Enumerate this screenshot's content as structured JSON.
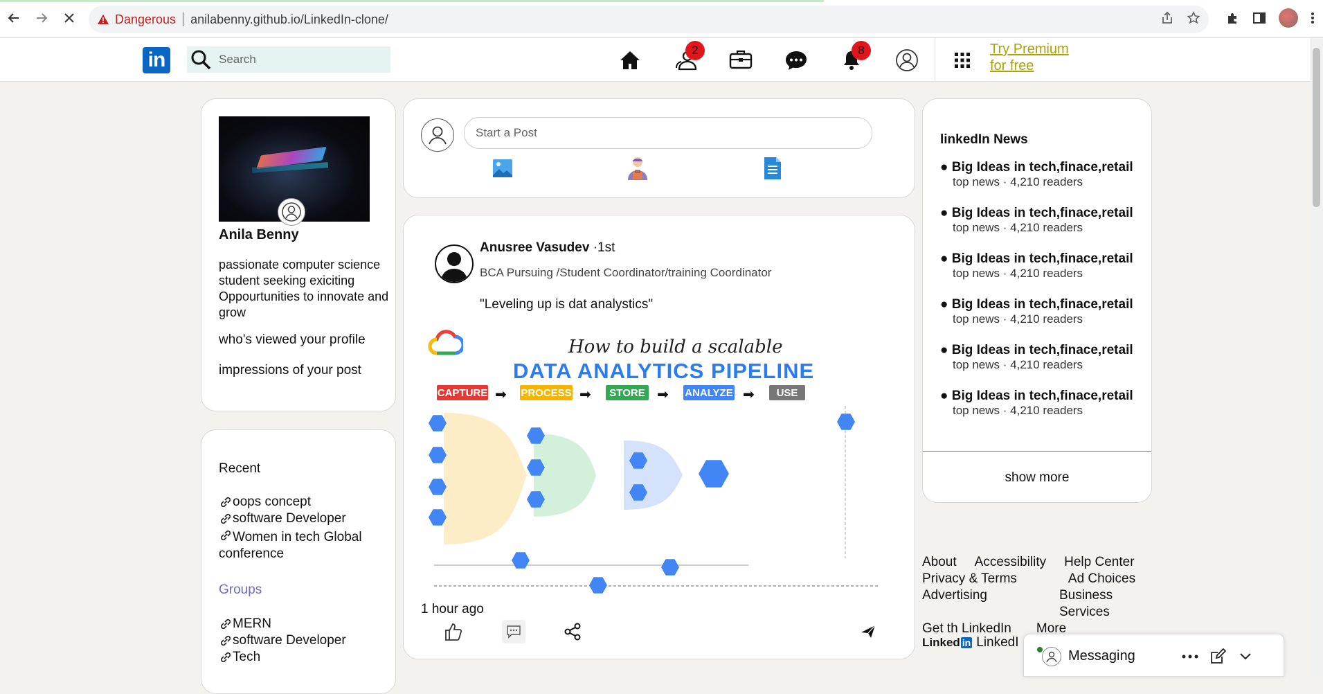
{
  "browser": {
    "security_label": "Dangerous",
    "url": "anilabenny.github.io/LinkedIn-clone/"
  },
  "header": {
    "logo_text": "in",
    "search_placeholder": "Search",
    "network_badge": "2",
    "notifications_badge": "8",
    "premium_line1": "Try Premium",
    "premium_line2": "for free"
  },
  "profile": {
    "name": "Anila Benny",
    "bio": "passionate computer science student seeking exiciting Oppourtunities to innovate and grow",
    "viewed": "who's viewed your profile",
    "impressions": "impressions of your post"
  },
  "recent": {
    "title": "Recent",
    "items": [
      "oops concept",
      "software Developer",
      "Women in tech Global conference"
    ],
    "groups_title": "Groups",
    "groups": [
      "MERN",
      "software Developer",
      "Tech"
    ]
  },
  "composer": {
    "placeholder": "Start a Post"
  },
  "post": {
    "author": "Anusree Vasudev",
    "degree": "·1st",
    "role": "BCA Pursuing /Student Coordinator/training Coordinator",
    "text": "\"Leveling up is dat analystics\"",
    "image": {
      "title": "How to build a scalable",
      "subtitle": "DATA ANALYTICS PIPELINE",
      "stages": [
        "CAPTURE",
        "PROCESS",
        "STORE",
        "ANALYZE",
        "USE"
      ],
      "colors": {
        "capture": "#e53935",
        "process": "#f5b400",
        "store": "#34a853",
        "analyze": "#4285f4",
        "use": "#777777"
      }
    },
    "time": "1 hour ago"
  },
  "news": {
    "title": "linkedIn News",
    "items": [
      {
        "headline": "Big Ideas in tech,finace,retail",
        "meta": "top news · 4,210 readers"
      },
      {
        "headline": "Big Ideas in tech,finace,retail",
        "meta": "top news · 4,210 readers"
      },
      {
        "headline": "Big Ideas in tech,finace,retail",
        "meta": "top news · 4,210 readers"
      },
      {
        "headline": "Big Ideas in tech,finace,retail",
        "meta": "top news · 4,210 readers"
      },
      {
        "headline": "Big Ideas in tech,finace,retail",
        "meta": "top news · 4,210 readers"
      },
      {
        "headline": "Big Ideas in tech,finace,retail",
        "meta": "top news · 4,210 readers"
      }
    ],
    "show_more": "show more"
  },
  "footer": {
    "about": "About",
    "accessibility": "Accessibility",
    "help": "Help Center",
    "privacy": "Privacy & Terms",
    "ad_choices": "Ad Choices",
    "advertising": "Advertising",
    "business": "Business Services",
    "get_app": "Get th LinkedIn",
    "more": "More",
    "brand_word": "Linked",
    "brand_in": "in",
    "brand_text": "LinkedI"
  },
  "messaging": {
    "label": "Messaging"
  },
  "colors": {
    "brand": "#0a66c2",
    "premium": "#a8a20d",
    "badge": "#e0161b",
    "groups": "#6b6bbf"
  }
}
